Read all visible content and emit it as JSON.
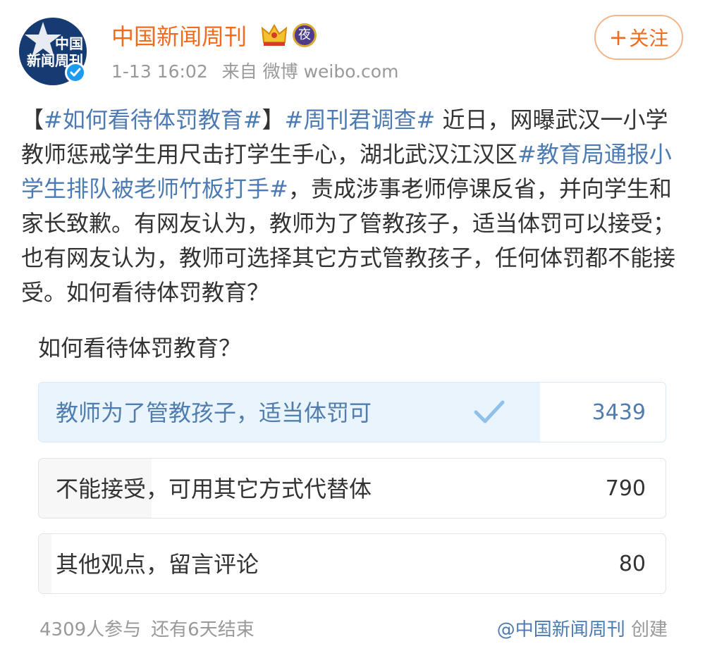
{
  "header": {
    "avatar_text": [
      "中国",
      "新闻周刊"
    ],
    "account_name": "中国新闻周刊",
    "night_badge": "夜",
    "crown_icon": "crown-icon",
    "verified_icon": "verified-check-icon",
    "timestamp": "1-13 16:02",
    "source": "来自 微博 weibo.com",
    "follow_label": "关注",
    "follow_plus": "+"
  },
  "post": {
    "bracket_open": "【",
    "tag1": "#如何看待体罚教育#",
    "bracket_close": "】",
    "tag2": "#周刊君调查#",
    "text1": " 近日，网曝武汉一小学教师惩戒学生用尺击打学生手心，湖北武汉江汉区",
    "tag3": "#教育局通报小学生排队被老师竹板打手#",
    "text2": "，责成涉事老师停课反省，并向学生和家长致歉。有网友认为，教师为了管教孩子，适当体罚可以接受；也有网友认为，教师可选择其它方式管教孩子，任何体罚都不能接受。如何看待体罚教育？"
  },
  "poll": {
    "question": "如何看待体罚教育？",
    "options": [
      {
        "label": "教师为了管教孩子，适当体罚可",
        "count": "3439",
        "selected": true,
        "share": 0.8
      },
      {
        "label": "不能接受，可用其它方式代替体",
        "count": "790",
        "selected": false,
        "share": 0.18
      },
      {
        "label": "其他观点，留言评论",
        "count": "80",
        "selected": false,
        "share": 0.02
      }
    ],
    "participants": "4309人参与",
    "remaining": "还有6天结束",
    "creator_name": "@中国新闻周刊",
    "creator_suffix": " 创建"
  },
  "colors": {
    "brand_orange": "#f26b1d",
    "link_blue": "#4c7ab3",
    "selected_fill": "#eaf4fd",
    "muted_gray": "#999999"
  }
}
